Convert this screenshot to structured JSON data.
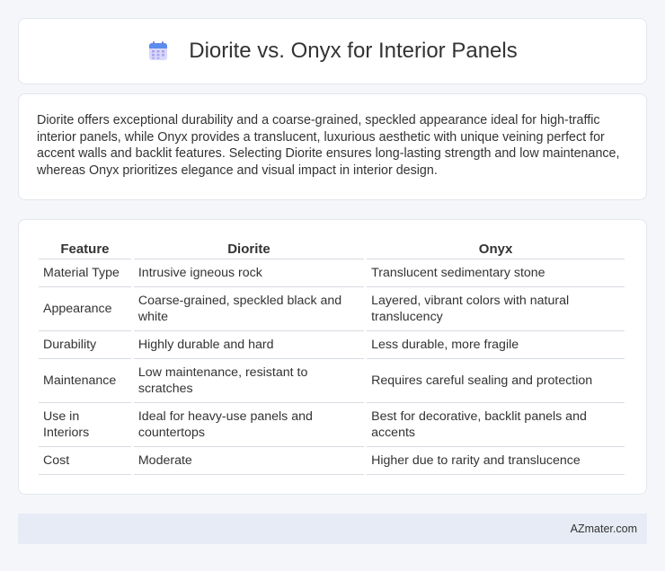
{
  "header": {
    "title": "Diorite vs. Onyx for Interior Panels",
    "icon": "calendar-icon",
    "icon_color": "#8a86e6"
  },
  "summary": {
    "text": "Diorite offers exceptional durability and a coarse-grained, speckled appearance ideal for high-traffic interior panels, while Onyx provides a translucent, luxurious aesthetic with unique veining perfect for accent walls and backlit features. Selecting Diorite ensures long-lasting strength and low maintenance, whereas Onyx prioritizes elegance and visual impact in interior design."
  },
  "table": {
    "headers": [
      "Feature",
      "Diorite",
      "Onyx"
    ],
    "rows": [
      [
        "Material Type",
        "Intrusive igneous rock",
        "Translucent sedimentary stone"
      ],
      [
        "Appearance",
        "Coarse-grained, speckled black and white",
        "Layered, vibrant colors with natural translucency"
      ],
      [
        "Durability",
        "Highly durable and hard",
        "Less durable, more fragile"
      ],
      [
        "Maintenance",
        "Low maintenance, resistant to scratches",
        "Requires careful sealing and protection"
      ],
      [
        "Use in Interiors",
        "Ideal for heavy-use panels and countertops",
        "Best for decorative, backlit panels and accents"
      ],
      [
        "Cost",
        "Moderate",
        "Higher due to rarity and translucence"
      ]
    ]
  },
  "footer": {
    "text": "AZmater.com"
  }
}
